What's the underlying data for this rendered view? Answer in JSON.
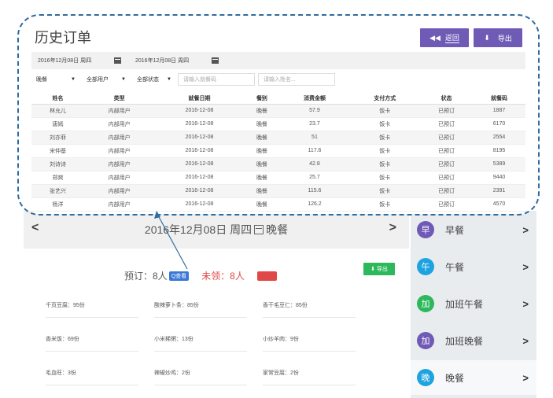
{
  "panel": {
    "title": "历史订单",
    "back_label": "返回",
    "back_icon": "double-chevron-left-icon",
    "export_label": "导出",
    "export_icon": "download-icon"
  },
  "filters": {
    "start_date": "2016年12月08日 周四",
    "end_date": "2016年12月08日 周四",
    "meal": "晚餐",
    "user_type": "全部用户",
    "status": "全部状态",
    "code_placeholder": "请输入就餐码",
    "name_placeholder": "请输入姓名..."
  },
  "table": {
    "columns": [
      "姓名",
      "类型",
      "就餐日期",
      "餐别",
      "消费金额",
      "支付方式",
      "状态",
      "就餐码"
    ],
    "rows": [
      [
        "林允儿",
        "内部用户",
        "2016-12-08",
        "晚餐",
        "57.9",
        "饭卡",
        "已预订",
        "1887"
      ],
      [
        "唐嫣",
        "内部用户",
        "2016-12-08",
        "晚餐",
        "23.7",
        "饭卡",
        "已预订",
        "6170"
      ],
      [
        "刘亦菲",
        "内部用户",
        "2016-12-08",
        "晚餐",
        "51",
        "饭卡",
        "已预订",
        "2554"
      ],
      [
        "宋仲基",
        "内部用户",
        "2016-12-08",
        "晚餐",
        "117.6",
        "饭卡",
        "已预订",
        "8195"
      ],
      [
        "刘诗诗",
        "内部用户",
        "2016-12-08",
        "晚餐",
        "42.8",
        "饭卡",
        "已预订",
        "5389"
      ],
      [
        "郑爽",
        "内部用户",
        "2016-12-08",
        "晚餐",
        "25.7",
        "饭卡",
        "已预订",
        "9440"
      ],
      [
        "张艺兴",
        "内部用户",
        "2016-12-08",
        "晚餐",
        "115.6",
        "饭卡",
        "已预订",
        "2391"
      ],
      [
        "杨洋",
        "内部用户",
        "2016-12-08",
        "晚餐",
        "126.2",
        "饭卡",
        "已预订",
        "4570"
      ]
    ]
  },
  "meal_page": {
    "date_title": "2016年12月08日 周四",
    "meal_title": "晚餐",
    "reserved": "预订：8人",
    "unclaimed": "未领：8人",
    "view_label": "Q查看",
    "export_label": "导出",
    "dishes": [
      "千页豆腐：95份",
      "酸辣萝卜条：85份",
      "香干毛豆仁：85份",
      "香米饭：69份",
      "小米稀粥：13份",
      "小炒羊肉：9份",
      "毛血旺：3份",
      "辣椒炒鸡：2份",
      "家常豆腐：2份"
    ]
  },
  "meal_menu": [
    {
      "icon": "早",
      "label": "早餐",
      "color": "#6f5ab5"
    },
    {
      "icon": "午",
      "label": "午餐",
      "color": "#1fa3e0"
    },
    {
      "icon": "加",
      "label": "加班午餐",
      "color": "#2eb85c"
    },
    {
      "icon": "加",
      "label": "加班晚餐",
      "color": "#6f5ab5"
    },
    {
      "icon": "晚",
      "label": "晚餐",
      "color": "#1fa3e0"
    }
  ],
  "colors": {
    "accent": "#6f5ab5",
    "outline": "#2f6ca0",
    "green": "#2eb85c",
    "red": "#e04848"
  }
}
